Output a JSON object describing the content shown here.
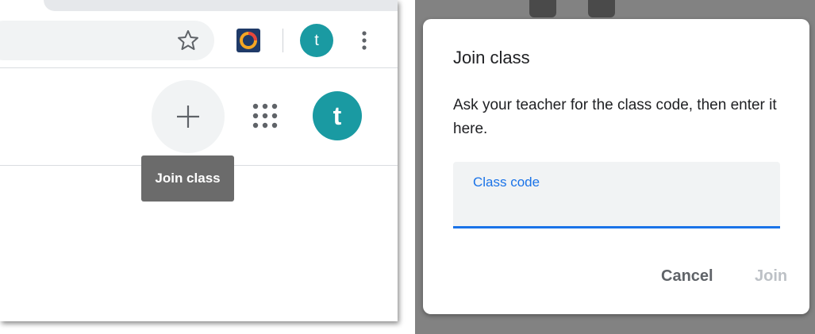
{
  "browser": {
    "profile_initial": "t",
    "bookmark_icon": "star-icon",
    "extension_icon": "extension-icon",
    "menu_icon": "kebab-menu-icon"
  },
  "header": {
    "add_icon": "plus-icon",
    "apps_icon": "apps-grid-icon",
    "account_initial": "t",
    "tooltip": "Join class"
  },
  "dialog": {
    "title": "Join class",
    "instructions": "Ask your teacher for the class code, then enter it here.",
    "field_label": "Class code",
    "field_value": "",
    "cancel_label": "Cancel",
    "join_label": "Join"
  },
  "colors": {
    "avatar": "#1a9aa2",
    "accent": "#1a73e8",
    "disabled_text": "#bdc1c6",
    "tooltip_bg": "#6b6b6b",
    "backdrop": "#828282"
  }
}
